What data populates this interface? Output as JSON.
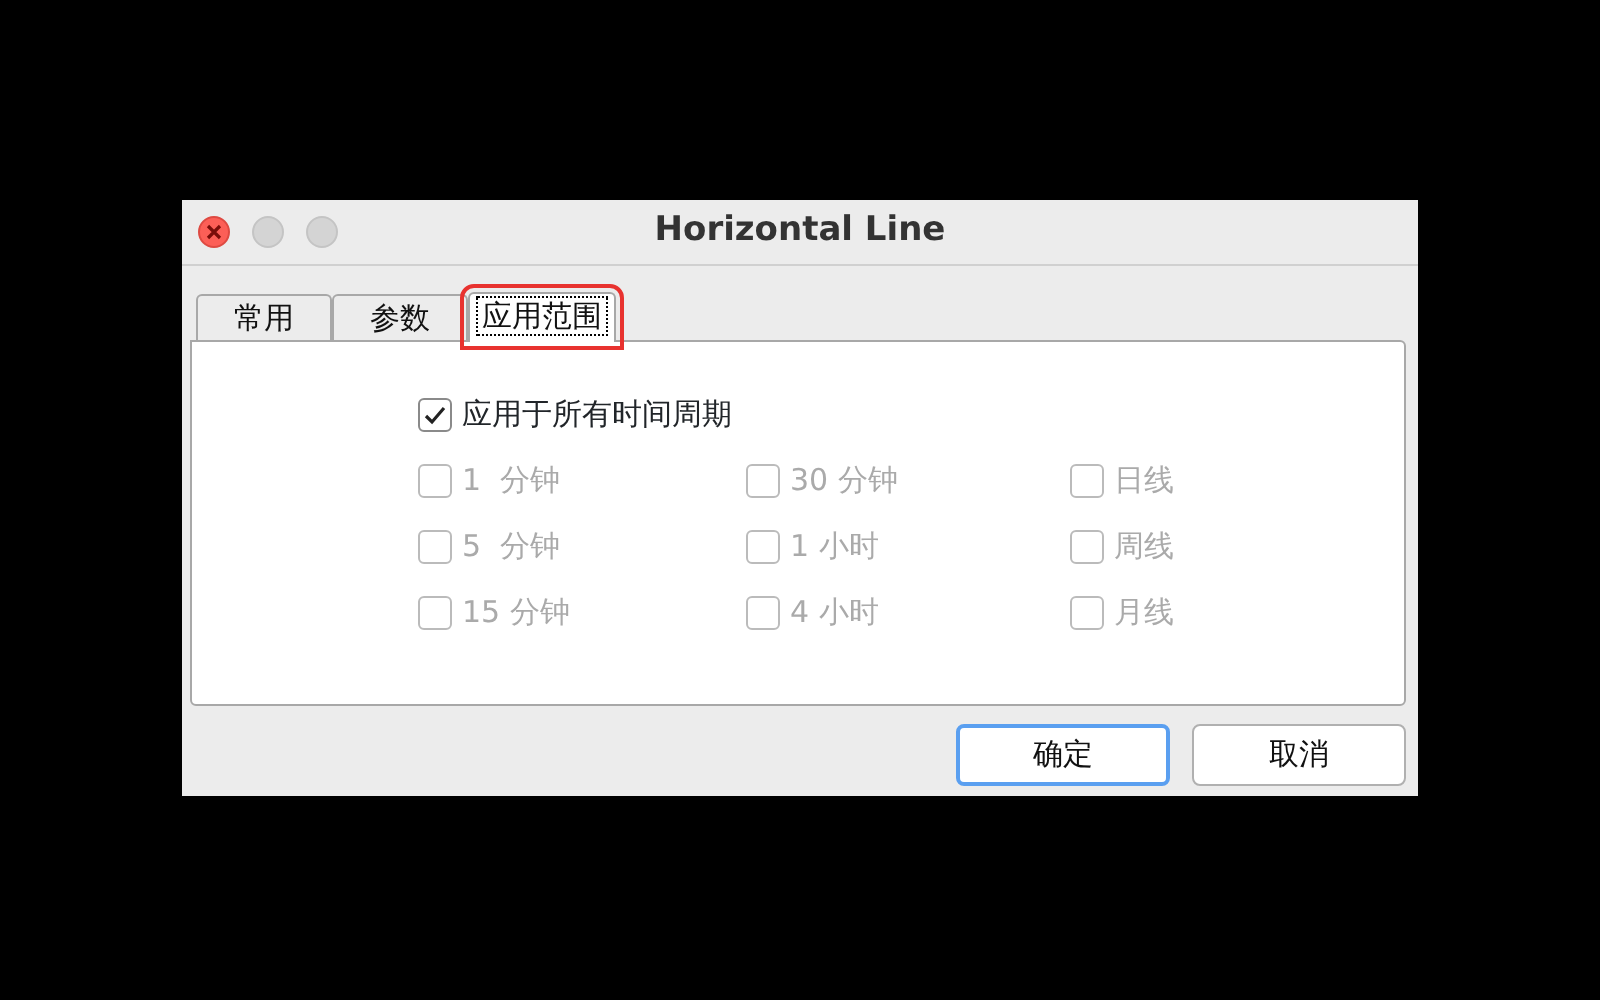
{
  "window": {
    "title": "Horizontal Line"
  },
  "tabs": [
    {
      "label": "常用",
      "selected": false,
      "highlighted": false
    },
    {
      "label": "参数",
      "selected": false,
      "highlighted": false
    },
    {
      "label": "应用范围",
      "selected": true,
      "highlighted": true
    }
  ],
  "apply_all": {
    "label": "应用于所有时间周期",
    "checked": true,
    "disabled": false
  },
  "periods": [
    {
      "label": "1  分钟",
      "checked": false,
      "disabled": true
    },
    {
      "label": "30 分钟",
      "checked": false,
      "disabled": true
    },
    {
      "label": "日线",
      "checked": false,
      "disabled": true
    },
    {
      "label": "5  分钟",
      "checked": false,
      "disabled": true
    },
    {
      "label": "1 小时",
      "checked": false,
      "disabled": true
    },
    {
      "label": "周线",
      "checked": false,
      "disabled": true
    },
    {
      "label": "15 分钟",
      "checked": false,
      "disabled": true
    },
    {
      "label": "4 小时",
      "checked": false,
      "disabled": true
    },
    {
      "label": "月线",
      "checked": false,
      "disabled": true
    }
  ],
  "buttons": [
    {
      "label": "确定",
      "default": true
    },
    {
      "label": "取消",
      "default": false
    }
  ]
}
